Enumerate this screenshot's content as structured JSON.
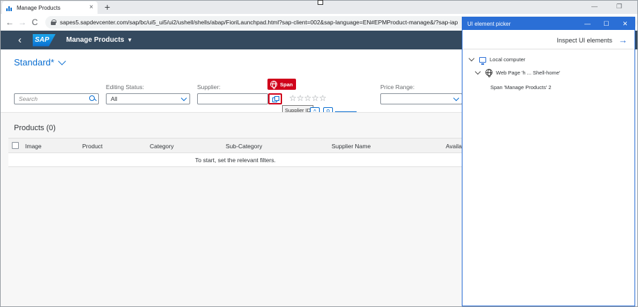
{
  "browser": {
    "tab_title": "Manage Products",
    "tab_close": "×",
    "new_tab": "+",
    "back": "←",
    "forward": "→",
    "reload": "C",
    "url": "sapes5.sapdevcenter.com/sap/bc/ui5_ui5/ui2/ushell/shells/abap/FioriLaunchpad.html?sap-client=002&sap-language=EN#EPMProduct-manage&/?sap-iap",
    "window_minimize": "—",
    "window_restore": "❐"
  },
  "shell": {
    "back": "‹",
    "logo": "SAP",
    "app_title": "Manage Products",
    "app_caret": "▼"
  },
  "variant": {
    "label": "Standard*"
  },
  "filters": {
    "search": {
      "placeholder": "Search"
    },
    "editing_status": {
      "label": "Editing Status:",
      "value": "All"
    },
    "supplier": {
      "label": "Supplier:",
      "value": ""
    },
    "price_range": {
      "label": "Price Range:",
      "value": ""
    },
    "rating_stars": "☆☆☆☆☆"
  },
  "highlight": {
    "badge_label": "Span",
    "tooltip": "Supplier ID"
  },
  "products": {
    "title": "Products (0)",
    "columns": [
      "Image",
      "Product",
      "Category",
      "Sub-Category",
      "Supplier Name",
      "Availa"
    ],
    "empty_message": "To start, set the relevant filters."
  },
  "picker": {
    "title": "UI element picker",
    "controls": [
      "—",
      "☐",
      "✕"
    ],
    "inspect_label": "Inspect UI elements",
    "inspect_arrow": "→",
    "tree": [
      {
        "label": "Local computer",
        "icon": "monitor-icon"
      },
      {
        "label": "Web Page 'h ... Shell-home'",
        "icon": "globe-icon"
      },
      {
        "label": "Span 'Manage Products' 2",
        "icon": ""
      }
    ]
  },
  "colors": {
    "shell": "#354a5f",
    "accent": "#0a6ed1",
    "highlight": "#d0021b",
    "picker_accent": "#2b6fd6"
  }
}
